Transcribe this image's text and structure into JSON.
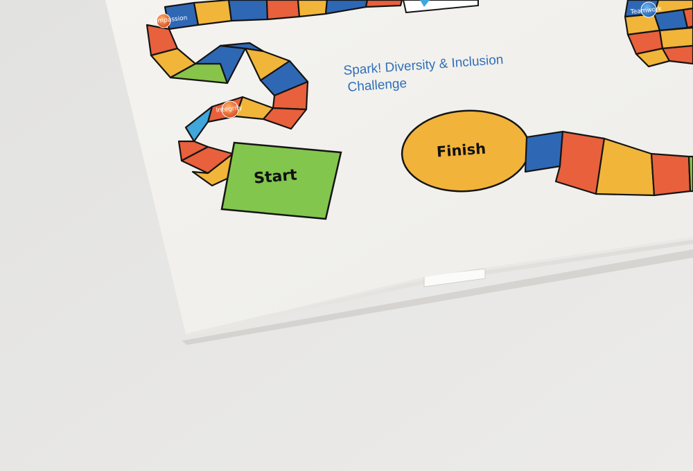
{
  "board": {
    "title_line1": "Spark! Diversity & Inclusion",
    "title_line2": "Challenge",
    "start_label": "Start",
    "finish_label": "Finish",
    "badges": [
      "Compassion",
      "Integrity",
      "Teamwork"
    ]
  },
  "colors": {
    "orange": "#e8603c",
    "blue": "#2e68b5",
    "yellow": "#f1b53a",
    "green": "#88c34a",
    "light_blue": "#3fa7dc",
    "start_green": "#82c64e",
    "finish_yellow": "#f2b33a",
    "title_blue": "#2f6fb8",
    "paper": "#f3f2ee",
    "background": "#e7e7e5"
  }
}
